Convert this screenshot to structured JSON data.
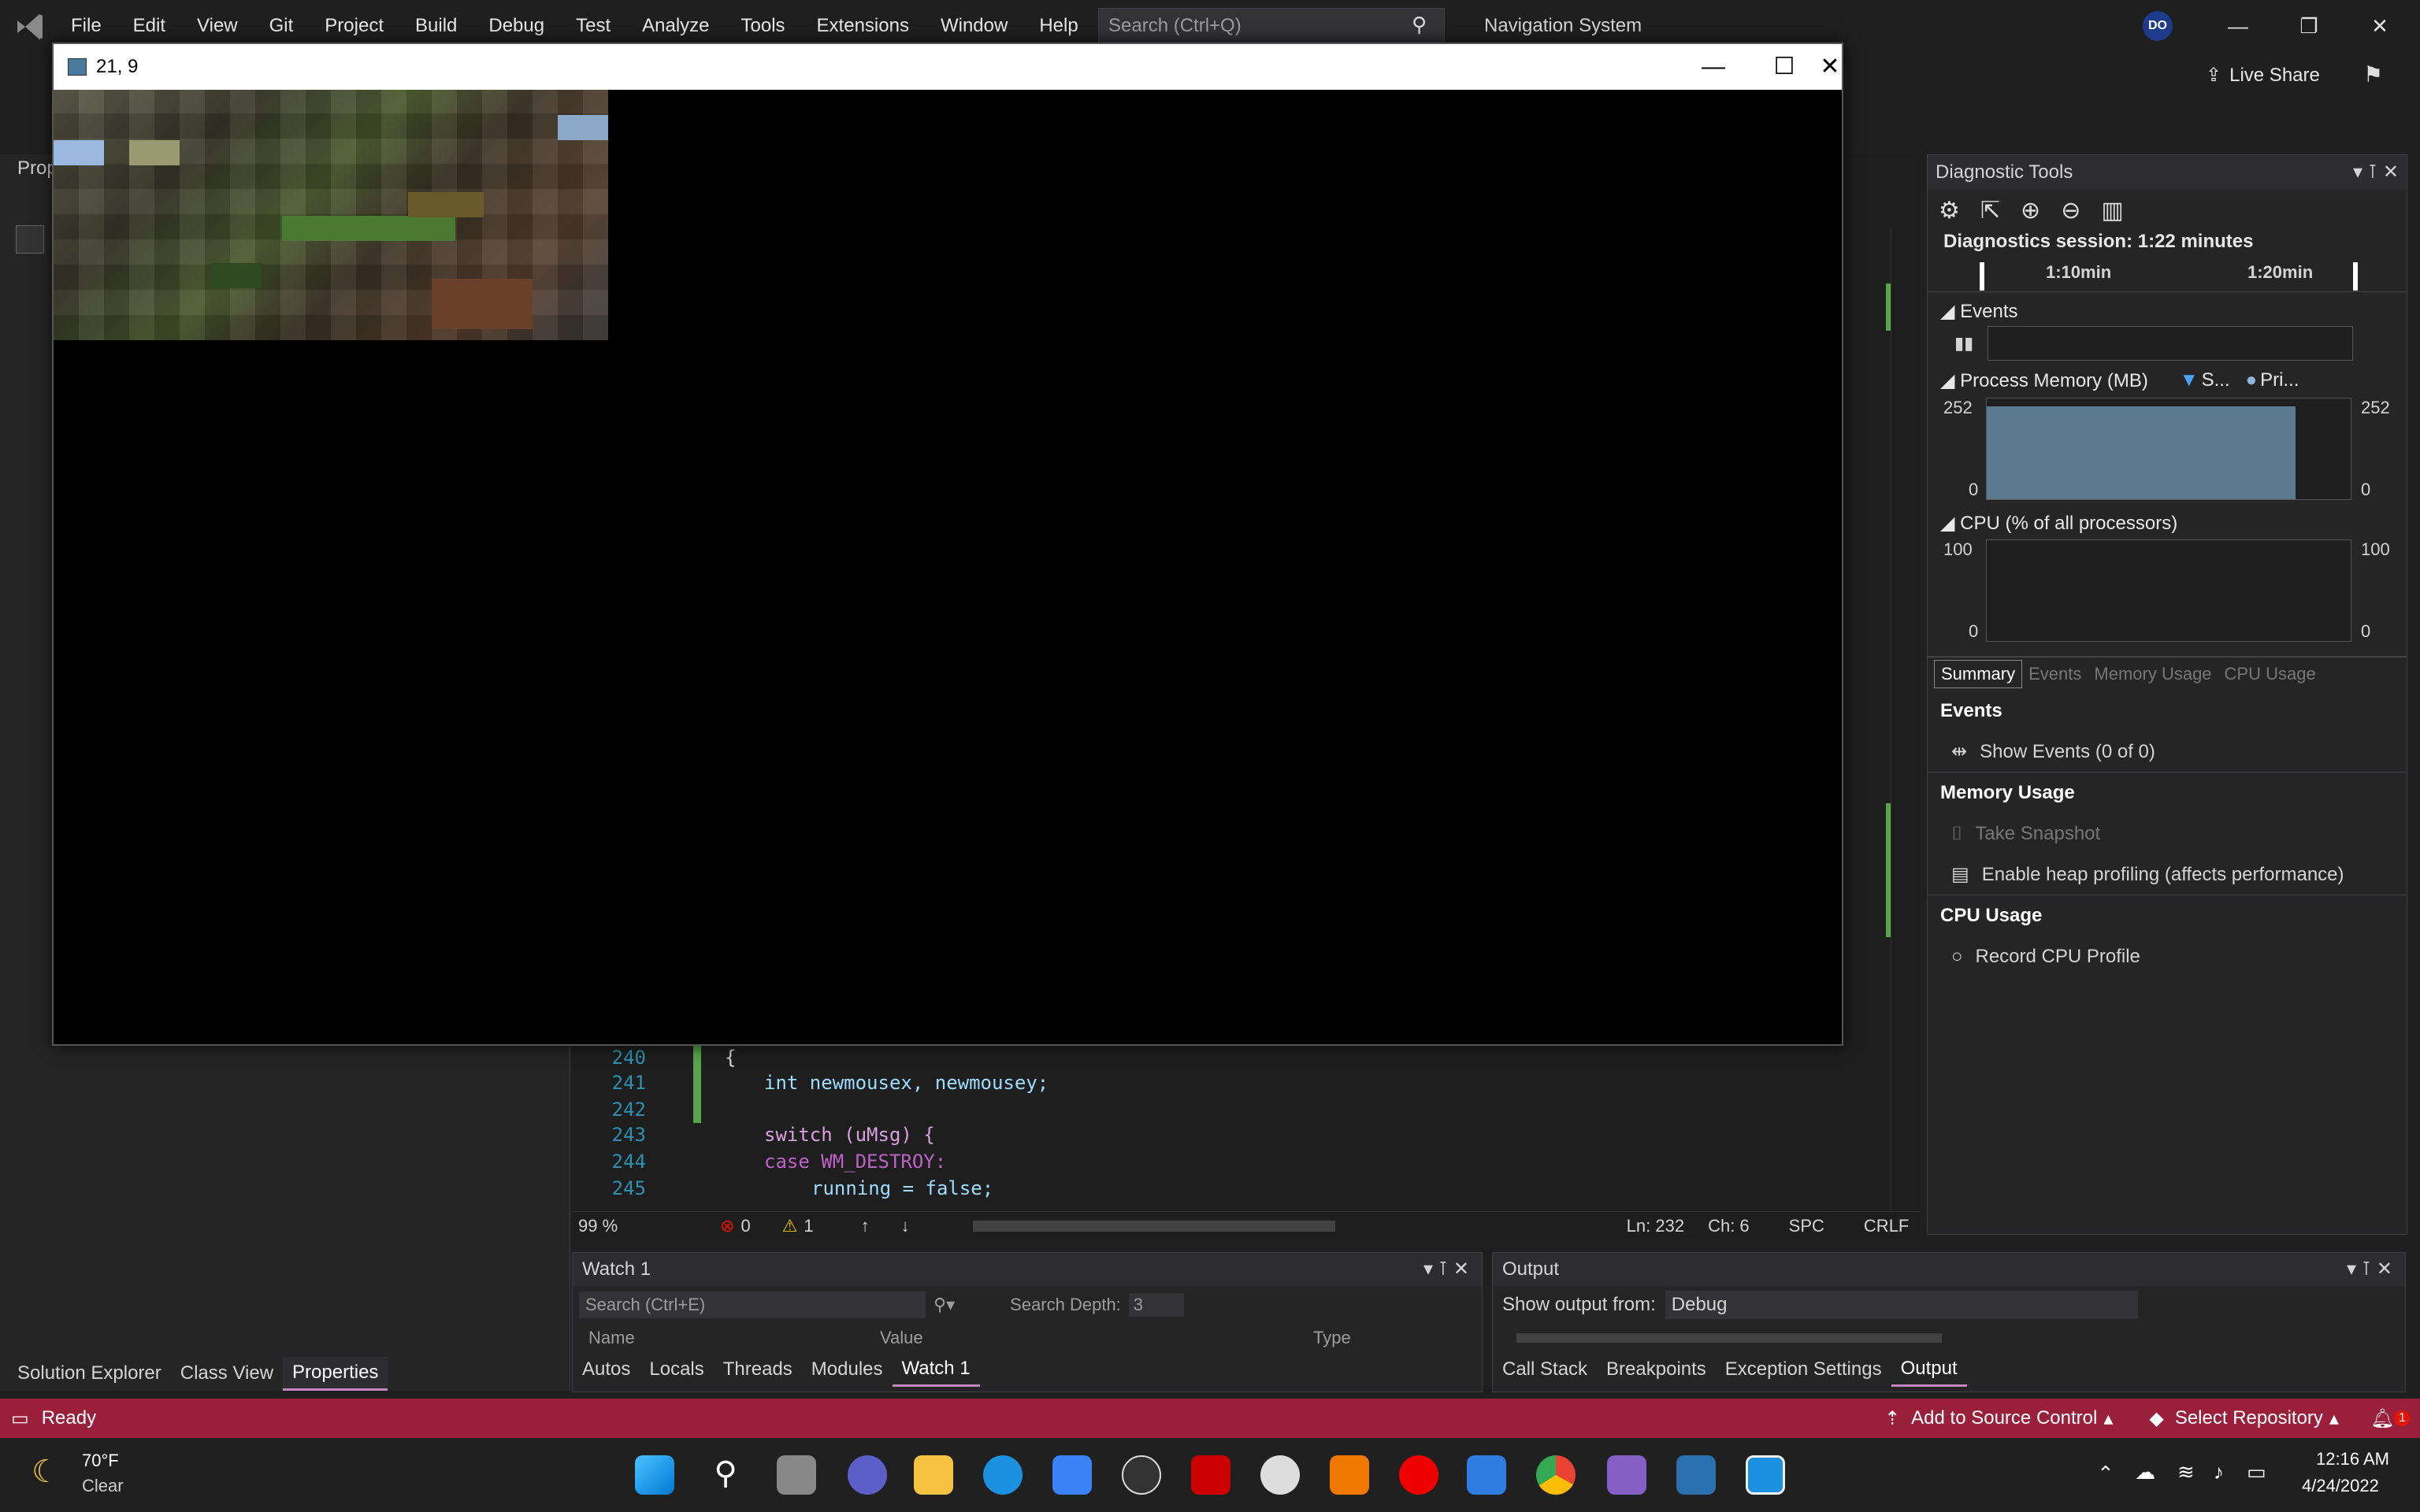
{
  "menu": [
    "File",
    "Edit",
    "View",
    "Git",
    "Project",
    "Build",
    "Debug",
    "Test",
    "Analyze",
    "Tools",
    "Extensions",
    "Window",
    "Help"
  ],
  "search": {
    "placeholder": "Search (Ctrl+Q)"
  },
  "solution_title": "Navigation System",
  "user_initials": "DO",
  "live_share": "Live Share",
  "left_panel": {
    "header": "Prop",
    "tabs": [
      "Solution Explorer",
      "Class View",
      "Properties"
    ],
    "active_tab": "Properties"
  },
  "game_window": {
    "title": "21, 9"
  },
  "code": [
    {
      "ln": "240",
      "text": "{"
    },
    {
      "ln": "241",
      "text": "int newmousex, newmousey;"
    },
    {
      "ln": "242",
      "text": ""
    },
    {
      "ln": "243",
      "text": "switch (uMsg) {"
    },
    {
      "ln": "244",
      "text": "case WM_DESTROY:"
    },
    {
      "ln": "245",
      "text": "running = false;"
    }
  ],
  "editor_status": {
    "zoom": "99 %",
    "errors": "0",
    "warnings": "1",
    "line": "Ln: 232",
    "char": "Ch: 6",
    "spacing": "SPC",
    "eol": "CRLF"
  },
  "watch": {
    "title": "Watch 1",
    "search_placeholder": "Search (Ctrl+E)",
    "search_depth_label": "Search Depth:",
    "search_depth": "3",
    "columns": [
      "Name",
      "Value",
      "Type"
    ],
    "tabs": [
      "Autos",
      "Locals",
      "Threads",
      "Modules",
      "Watch 1"
    ],
    "active_tab": "Watch 1"
  },
  "output": {
    "title": "Output",
    "show_from_label": "Show output from:",
    "source": "Debug",
    "tabs": [
      "Call Stack",
      "Breakpoints",
      "Exception Settings",
      "Output"
    ],
    "active_tab": "Output"
  },
  "diag": {
    "title": "Diagnostic Tools",
    "session": "Diagnostics session: 1:22 minutes",
    "timeline": [
      "1:10min",
      "1:20min"
    ],
    "events_label": "Events",
    "memory_label": "Process Memory (MB)",
    "memory_legend": [
      "S...",
      "Pri..."
    ],
    "memory_max": "252",
    "memory_min": "0",
    "cpu_label": "CPU (% of all processors)",
    "cpu_max": "100",
    "cpu_min": "0",
    "tabs": [
      "Summary",
      "Events",
      "Memory Usage",
      "CPU Usage"
    ],
    "events_section": "Events",
    "show_events": "Show Events (0 of 0)",
    "memory_section": "Memory Usage",
    "take_snapshot": "Take Snapshot",
    "heap_profiling": "Enable heap profiling (affects performance)",
    "cpu_section": "CPU Usage",
    "record_cpu": "Record CPU Profile"
  },
  "statusbar": {
    "ready": "Ready",
    "source_control": "Add to Source Control",
    "repo": "Select Repository",
    "notifications": "1"
  },
  "taskbar": {
    "temp": "70°F",
    "weather": "Clear",
    "time": "12:16 AM",
    "date": "4/24/2022"
  },
  "colors": {
    "accent": "#9a1f3a",
    "vs_purple": "#c586c0",
    "chart_fill": "#5a7a90"
  }
}
